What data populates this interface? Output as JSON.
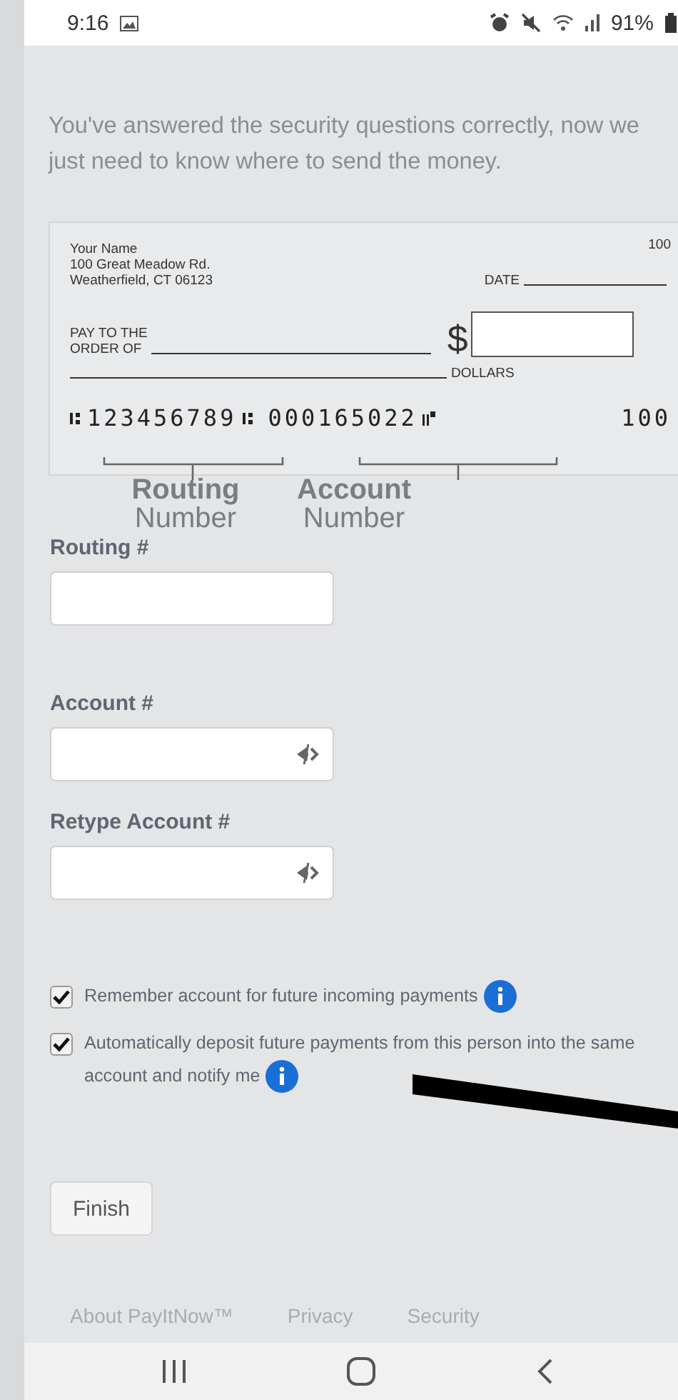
{
  "status_bar": {
    "time": "9:16",
    "battery": "91%"
  },
  "intro": "You've answered the security questions correctly, now we just need to know where to send the money.",
  "check": {
    "name": "Your Name",
    "address_1": "100 Great Meadow Rd.",
    "address_2": "Weatherfield, CT 06123",
    "number": "100",
    "date_label": "DATE",
    "pay_label_1": "PAY TO THE",
    "pay_label_2": "ORDER OF",
    "currency": "$",
    "dollars_label": "DOLLARS",
    "routing_digits": "123456789",
    "account_digits": "000165022",
    "check_digits": "100"
  },
  "callouts": [
    {
      "line_1": "Routing",
      "line_2": "Number"
    },
    {
      "line_1": "Account",
      "line_2": "Number"
    }
  ],
  "fields": [
    {
      "label": "Routing #",
      "kind": "plain"
    },
    {
      "label": "Account #",
      "kind": "secret"
    },
    {
      "label": "Retype Account #",
      "kind": "secret"
    }
  ],
  "options": [
    {
      "label": "Remember account for future incoming payments",
      "checked": true
    },
    {
      "label": "Automatically deposit future payments from this person into the same account and notify me",
      "checked": true
    }
  ],
  "finish_button": "Finish",
  "footer_links": [
    "About PayItNow™",
    "Privacy",
    "Security"
  ]
}
